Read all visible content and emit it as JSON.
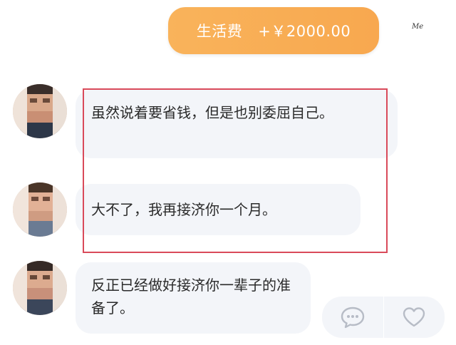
{
  "transfer": {
    "label": "生活费",
    "amount": "+￥2000.00",
    "color": "#f9ae55"
  },
  "me_label": "Me",
  "messages": [
    {
      "text": "虽然说着要省钱，但是也别委屈自己。"
    },
    {
      "text": "大不了，我再接济你一个月。"
    },
    {
      "text": "反正已经做好接济你一辈子的准备了。"
    }
  ],
  "actions": [
    {
      "icon": "comment-icon"
    },
    {
      "icon": "heart-icon"
    }
  ],
  "highlight_color": "#d94a5a"
}
